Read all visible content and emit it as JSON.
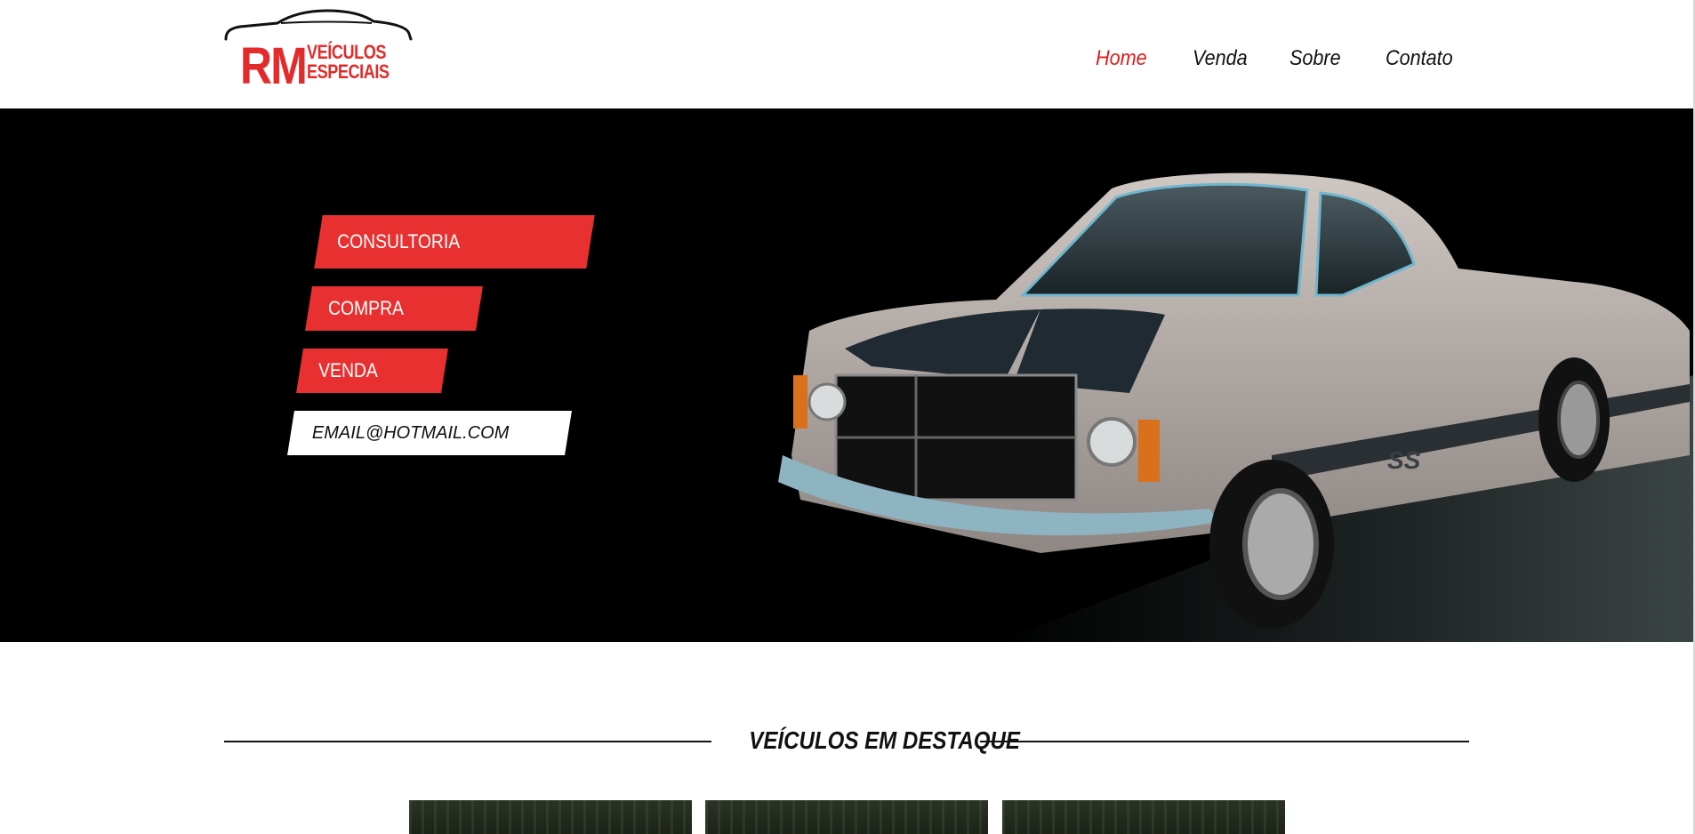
{
  "brand": {
    "logo_initials": "RM",
    "logo_line1": "VEÍCULOS",
    "logo_line2": "ESPECIAIS",
    "accent_color": "#e32b2b"
  },
  "nav": {
    "items": [
      {
        "label": "Home",
        "active": true
      },
      {
        "label": "Venda",
        "active": false
      },
      {
        "label": "Sobre",
        "active": false
      },
      {
        "label": "Contato",
        "active": false
      }
    ]
  },
  "hero": {
    "tags": [
      "CONSULTORIA",
      "COMPRA",
      "VENDA"
    ],
    "email_value": "EMAIL@HOTMAIL.COM",
    "image": "classic-car-photo"
  },
  "featured": {
    "title": "VEÍCULOS EM DESTAQUE"
  }
}
